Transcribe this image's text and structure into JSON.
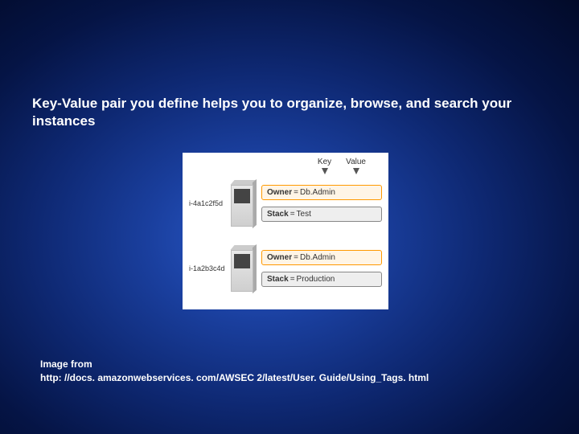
{
  "title": "Key-Value pair you define helps you to organize, browse, and search your instances",
  "caption_line1": "Image from",
  "caption_line2": "http: //docs. amazonwebservices. com/AWSEC 2/latest/User. Guide/Using_Tags. html",
  "diagram": {
    "column_labels": {
      "key": "Key",
      "value": "Value"
    },
    "instances": [
      {
        "id": "i-4a1c2f5d",
        "tags": [
          {
            "key": "Owner",
            "value": "Db.Admin",
            "style": "orange"
          },
          {
            "key": "Stack",
            "value": "Test",
            "style": "gray"
          }
        ]
      },
      {
        "id": "i-1a2b3c4d",
        "tags": [
          {
            "key": "Owner",
            "value": "Db.Admin",
            "style": "orange"
          },
          {
            "key": "Stack",
            "value": "Production",
            "style": "gray"
          }
        ]
      }
    ]
  }
}
